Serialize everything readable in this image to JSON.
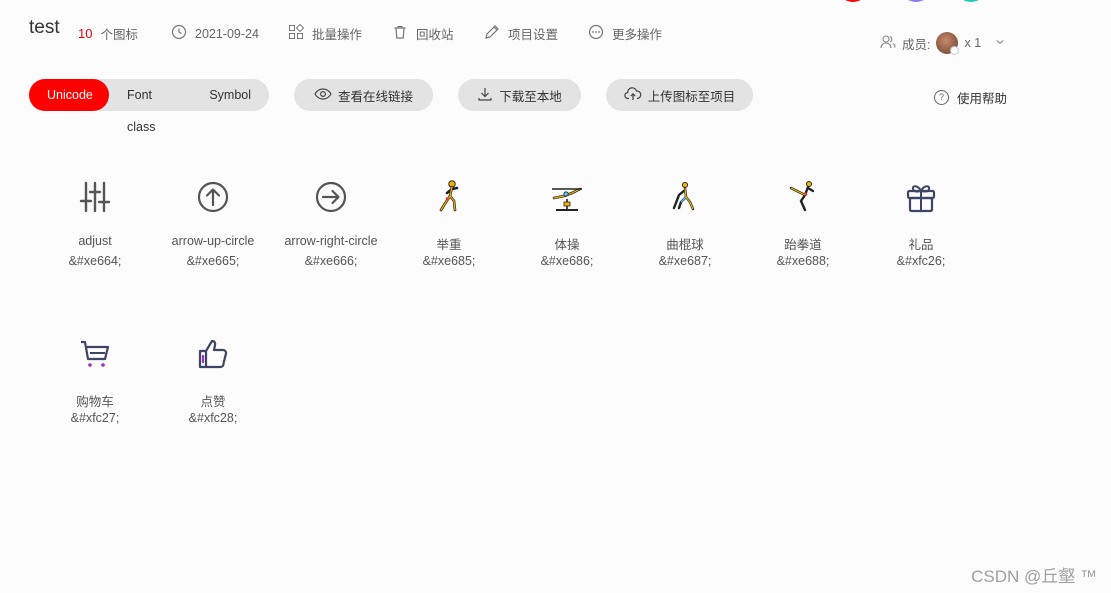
{
  "header": {
    "title": "test",
    "count": "10",
    "count_label": "个图标",
    "date": "2021-09-24",
    "batch": "批量操作",
    "recycle": "回收站",
    "settings": "项目设置",
    "more": "更多操作",
    "members_label": "成员:",
    "members_count": "x 1"
  },
  "tabs": [
    {
      "label": "Unicode"
    },
    {
      "label": "Font class"
    },
    {
      "label": "Symbol"
    }
  ],
  "actions": {
    "view_link": "查看在线链接",
    "download": "下载至本地",
    "upload": "上传图标至项目",
    "help": "使用帮助"
  },
  "icons": [
    {
      "name": "adjust",
      "code": "&#xe664;",
      "icon": "adjust-icon"
    },
    {
      "name": "arrow-up-circle",
      "code": "&#xe665;",
      "icon": "arrow-up-circle-icon"
    },
    {
      "name": "arrow-right-circle",
      "code": "&#xe666;",
      "icon": "arrow-right-circle-icon"
    },
    {
      "name": "举重",
      "code": "&#xe685;",
      "icon": "weightlifting-icon"
    },
    {
      "name": "体操",
      "code": "&#xe686;",
      "icon": "gymnastics-icon"
    },
    {
      "name": "曲棍球",
      "code": "&#xe687;",
      "icon": "hockey-icon"
    },
    {
      "name": "跆拳道",
      "code": "&#xe688;",
      "icon": "taekwondo-icon"
    },
    {
      "name": "礼品",
      "code": "&#xfc26;",
      "icon": "gift-icon"
    },
    {
      "name": "购物车",
      "code": "&#xfc27;",
      "icon": "shopping-cart-icon"
    },
    {
      "name": "点赞",
      "code": "&#xfc28;",
      "icon": "thumbs-up-icon"
    }
  ],
  "watermark": "CSDN @丘壑 ™",
  "colors": {
    "accent": "#ff0000",
    "pill_bg": "#e3e3e3",
    "count": "#e00000"
  }
}
